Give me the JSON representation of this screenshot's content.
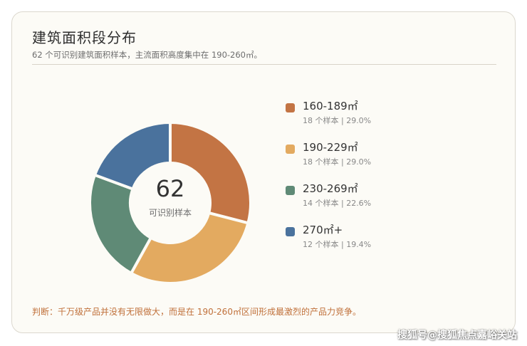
{
  "card": {
    "title": "建筑面积段分布",
    "subtitle": "62 个可识别建筑面积样本，主流面积高度集中在 190-260㎡。",
    "note": "判断：千万级产品并没有无限做大，而是在 190-260㎡区间形成最激烈的产品力竞争。"
  },
  "chart_data": {
    "type": "pie",
    "donut": true,
    "center_value": "62",
    "center_label": "可识别样本",
    "legend_position": "right",
    "slices": [
      {
        "label": "160-189㎡",
        "value": 18,
        "count_text": "18 个样本 | 29.0%",
        "color": "#c37444"
      },
      {
        "label": "190-229㎡",
        "value": 18,
        "count_text": "18 个样本 | 29.0%",
        "color": "#e3aa60"
      },
      {
        "label": "230-269㎡",
        "value": 14,
        "count_text": "14 个样本 | 22.6%",
        "color": "#5f8a76"
      },
      {
        "label": "270㎡+",
        "value": 12,
        "count_text": "12 个样本 | 19.4%",
        "color": "#4a729d"
      }
    ]
  },
  "watermark": "搜狐号@搜狐焦点嘉峪关站"
}
